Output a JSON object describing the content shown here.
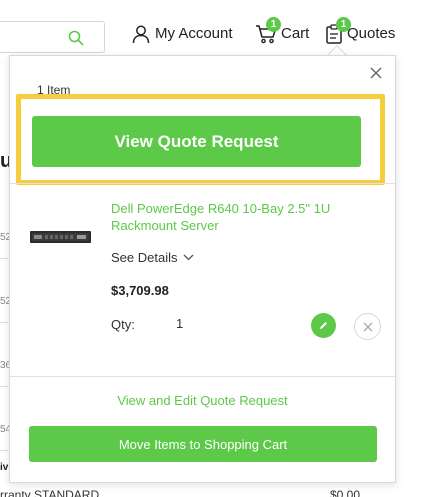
{
  "header": {
    "search": {
      "placeholder": ""
    },
    "account_label": "My Account",
    "cart_label": "Cart",
    "cart_count": "1",
    "quotes_label": "Quotes",
    "quotes_count": "1"
  },
  "background": {
    "fragments": [
      "u",
      "52",
      "52",
      "36",
      "54",
      "iv"
    ],
    "bottom_left": "rranty STANDARD",
    "bottom_right": "$0.00"
  },
  "popup": {
    "item_count": "1 Item",
    "view_quote_button": "View Quote Request",
    "product": {
      "name": "Dell PowerEdge R640 10-Bay 2.5\" 1U Rackmount Server",
      "see_details": "See Details",
      "price": "$3,709.98",
      "qty_label": "Qty:",
      "qty_value": "1"
    },
    "edit_link": "View and Edit Quote Request",
    "move_button": "Move Items to Shopping Cart"
  },
  "colors": {
    "accent": "#5cc948",
    "highlight": "#f6cd3c"
  }
}
